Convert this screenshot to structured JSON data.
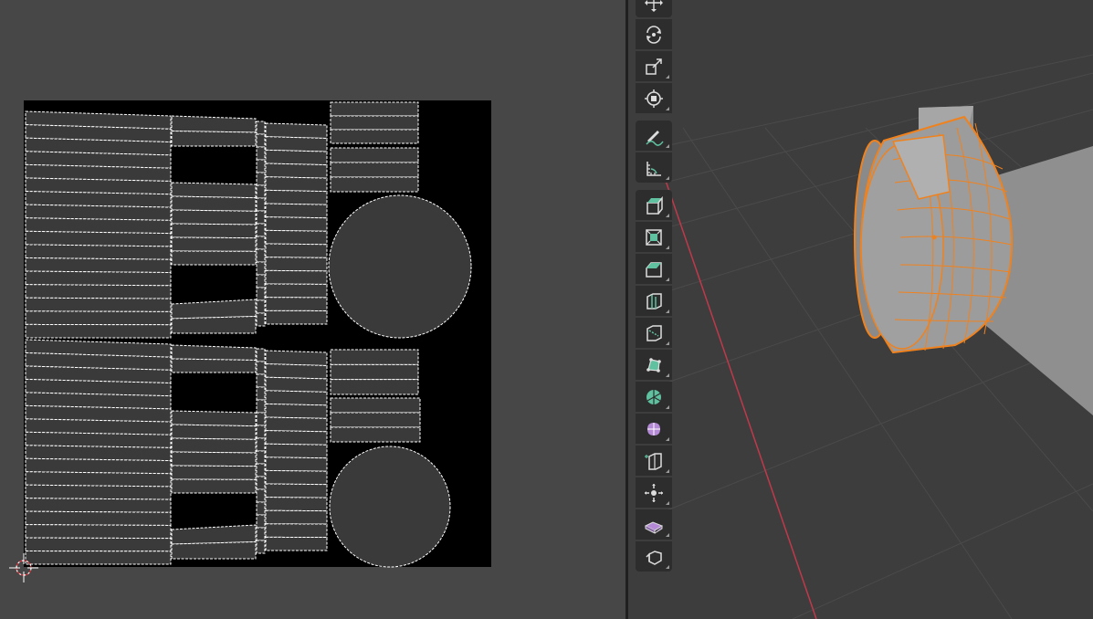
{
  "uv_editor": {
    "background_color": "#474747",
    "image_color": "#000000",
    "island_fill": "#3a3a3a",
    "island_edge": "#ffffff",
    "cursor_icon": "2d-cursor-icon"
  },
  "viewport": {
    "background_color": "#3d3d3d",
    "selection_color": "#f0821e",
    "x_axis_color": "#c0394b",
    "object_icon": "wheel-mesh",
    "toolbar": [
      {
        "id": "move",
        "icon": "move-icon",
        "active": false
      },
      {
        "id": "rotate",
        "icon": "rotate-icon",
        "active": false
      },
      {
        "id": "scale",
        "icon": "scale-icon",
        "active": false
      },
      {
        "id": "transform",
        "icon": "transform-icon",
        "active": false
      },
      {
        "id": "annotate",
        "icon": "annotate-icon",
        "active": false
      },
      {
        "id": "measure",
        "icon": "measure-icon",
        "active": false
      },
      {
        "id": "extrude",
        "icon": "extrude-region-icon",
        "active": false
      },
      {
        "id": "inset",
        "icon": "inset-faces-icon",
        "active": false
      },
      {
        "id": "bevel",
        "icon": "bevel-icon",
        "active": false
      },
      {
        "id": "loop-cut",
        "icon": "loop-cut-icon",
        "active": false
      },
      {
        "id": "knife",
        "icon": "knife-icon",
        "active": false
      },
      {
        "id": "poly-build",
        "icon": "poly-build-icon",
        "active": false
      },
      {
        "id": "spin",
        "icon": "spin-icon",
        "active": false
      },
      {
        "id": "smooth",
        "icon": "smooth-vertices-icon",
        "active": false
      },
      {
        "id": "edge-slide",
        "icon": "edge-slide-icon",
        "active": false
      },
      {
        "id": "shrink-fatten",
        "icon": "shrink-fatten-icon",
        "active": false
      },
      {
        "id": "shear",
        "icon": "shear-icon",
        "active": false
      },
      {
        "id": "rip-region",
        "icon": "rip-region-icon",
        "active": false
      }
    ]
  }
}
